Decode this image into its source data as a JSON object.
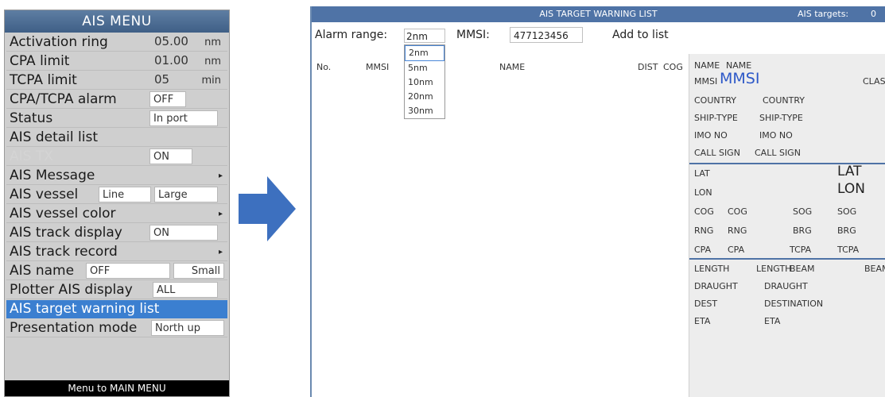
{
  "menu": {
    "title": "AIS MENU",
    "items": {
      "activation_ring": {
        "label": "Activation ring",
        "value": "05.00",
        "unit": "nm"
      },
      "cpa_limit": {
        "label": "CPA limit",
        "value": "01.00",
        "unit": "nm"
      },
      "tcpa_limit": {
        "label": "TCPA limit",
        "value": "05",
        "unit": "min"
      },
      "cpa_tcpa_alarm": {
        "label": "CPA/TCPA alarm",
        "value": "OFF"
      },
      "status": {
        "label": "Status",
        "value": "In port"
      },
      "ais_detail_list": {
        "label": "AIS detail list"
      },
      "ais_tx": {
        "label": "AIS TX",
        "value": "ON"
      },
      "ais_message": {
        "label": "AIS Message"
      },
      "ais_vessel": {
        "label": "AIS vessel",
        "value1": "Line",
        "value2": "Large"
      },
      "ais_vessel_color": {
        "label": "AIS vessel color"
      },
      "ais_track_display": {
        "label": "AIS track display",
        "value": "ON"
      },
      "ais_track_record": {
        "label": "AIS track record"
      },
      "ais_name": {
        "label": "AIS name",
        "value1": "OFF",
        "value2": "Small"
      },
      "plotter_ais_display": {
        "label": "Plotter AIS display",
        "value": "ALL"
      },
      "ais_target_warning_list": {
        "label": "AIS target warning list"
      },
      "presentation_mode": {
        "label": "Presentation mode",
        "value": "North up"
      }
    },
    "footer": "Menu to MAIN MENU",
    "submenu_arrow": "▸"
  },
  "panel": {
    "title": "AIS TARGET WARNING LIST",
    "targets_label": "AIS targets:",
    "targets_count": "0",
    "alarm_range_label": "Alarm range:",
    "alarm_range_value": "2nm",
    "mmsi_label": "MMSI:",
    "mmsi_value": "477123456",
    "add_to_list": "Add to list",
    "alarm_options": [
      "2nm",
      "5nm",
      "10nm",
      "20nm",
      "30nm"
    ],
    "columns": {
      "no": "No.",
      "mmsi": "MMSI",
      "name": "NAME",
      "dist": "DIST",
      "cog": "COG"
    }
  },
  "detail": {
    "name_label": "NAME",
    "name_value": "NAME",
    "mmsi_label": "MMSI",
    "mmsi_value": "MMSI",
    "class_label": "CLASS",
    "country_label": "COUNTRY",
    "country_value": "COUNTRY",
    "ship_type_label": "SHIP-TYPE",
    "ship_type_value": "SHIP-TYPE",
    "imo_label": "IMO NO",
    "imo_value": "IMO NO",
    "call_sign_label": "CALL SIGN",
    "call_sign_value": "CALL SIGN",
    "lat_label": "LAT",
    "lat_value": "LAT",
    "lon_label": "LON",
    "lon_value": "LON",
    "cog_label": "COG",
    "cog_value": "COG",
    "sog_label": "SOG",
    "sog_value": "SOG",
    "rng_label": "RNG",
    "rng_value": "RNG",
    "brg_label": "BRG",
    "brg_value": "BRG",
    "cpa_label": "CPA",
    "cpa_value": "CPA",
    "tcpa_label": "TCPA",
    "tcpa_value": "TCPA",
    "length_label": "LENGTH",
    "length_value": "LENGTH",
    "beam_label": "BEAM",
    "beam_value": "BEAM",
    "draught_label": "DRAUGHT",
    "draught_value": "DRAUGHT",
    "dest_label": "DEST",
    "dest_value": "DESTINATION",
    "eta_label": "ETA",
    "eta_value": "ETA"
  },
  "colors": {
    "accent": "#3b7fd0",
    "title_bar": "#4f73a6",
    "menu_bg": "#cfcfcf",
    "mmsi_highlight": "#2d58c8"
  }
}
